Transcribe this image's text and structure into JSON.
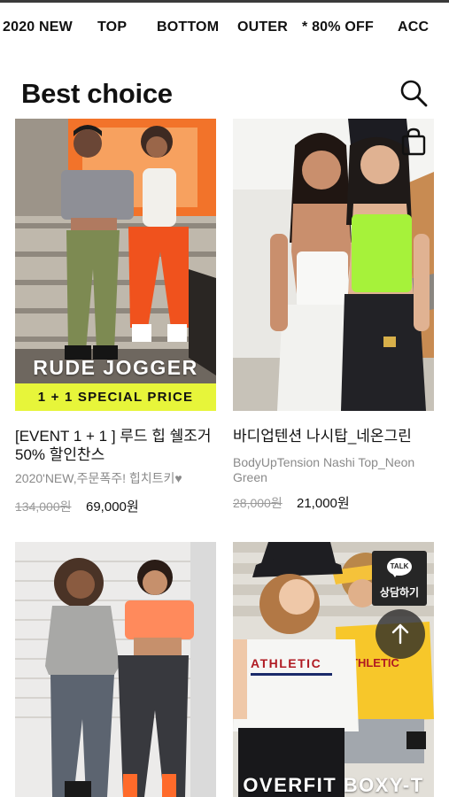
{
  "nav": {
    "items": [
      "2020 NEW",
      "TOP",
      "BOTTOM",
      "OUTER",
      "* 80% OFF",
      "ACC"
    ]
  },
  "section": {
    "title": "Best choice"
  },
  "products": [
    {
      "banner_title": "RUDE JOGGER",
      "banner_bar": "1 + 1  SPECIAL PRICE",
      "name": "[EVENT 1 + 1 ] 루드 힙 쉘조거 50% 할인찬스",
      "subtitle": "2020'NEW,주문폭주! 힙치트키♥",
      "price_original": "134,000원",
      "price_sale": "69,000원"
    },
    {
      "name": "바디업텐션 나시탑_네온그린",
      "subtitle": "BodyUpTension Nashi Top_Neon Green",
      "price_original": "28,000원",
      "price_sale": "21,000원"
    },
    {
      "name": ""
    },
    {
      "banner_title": "OVERFIT BOXY-T",
      "shirt_text": "ATHLETIC",
      "shirt_text_2": "THLETIC"
    }
  ],
  "floating": {
    "talk_badge": "TALK",
    "talk_label": "상담하기",
    "icons": [
      "shopping-bag-icon",
      "arrow-up-icon",
      "search-icon"
    ]
  },
  "colors": {
    "accent_bar": "#e7f53a",
    "neon_green": "#a6f23a",
    "orange_pants": "#f0521d"
  }
}
